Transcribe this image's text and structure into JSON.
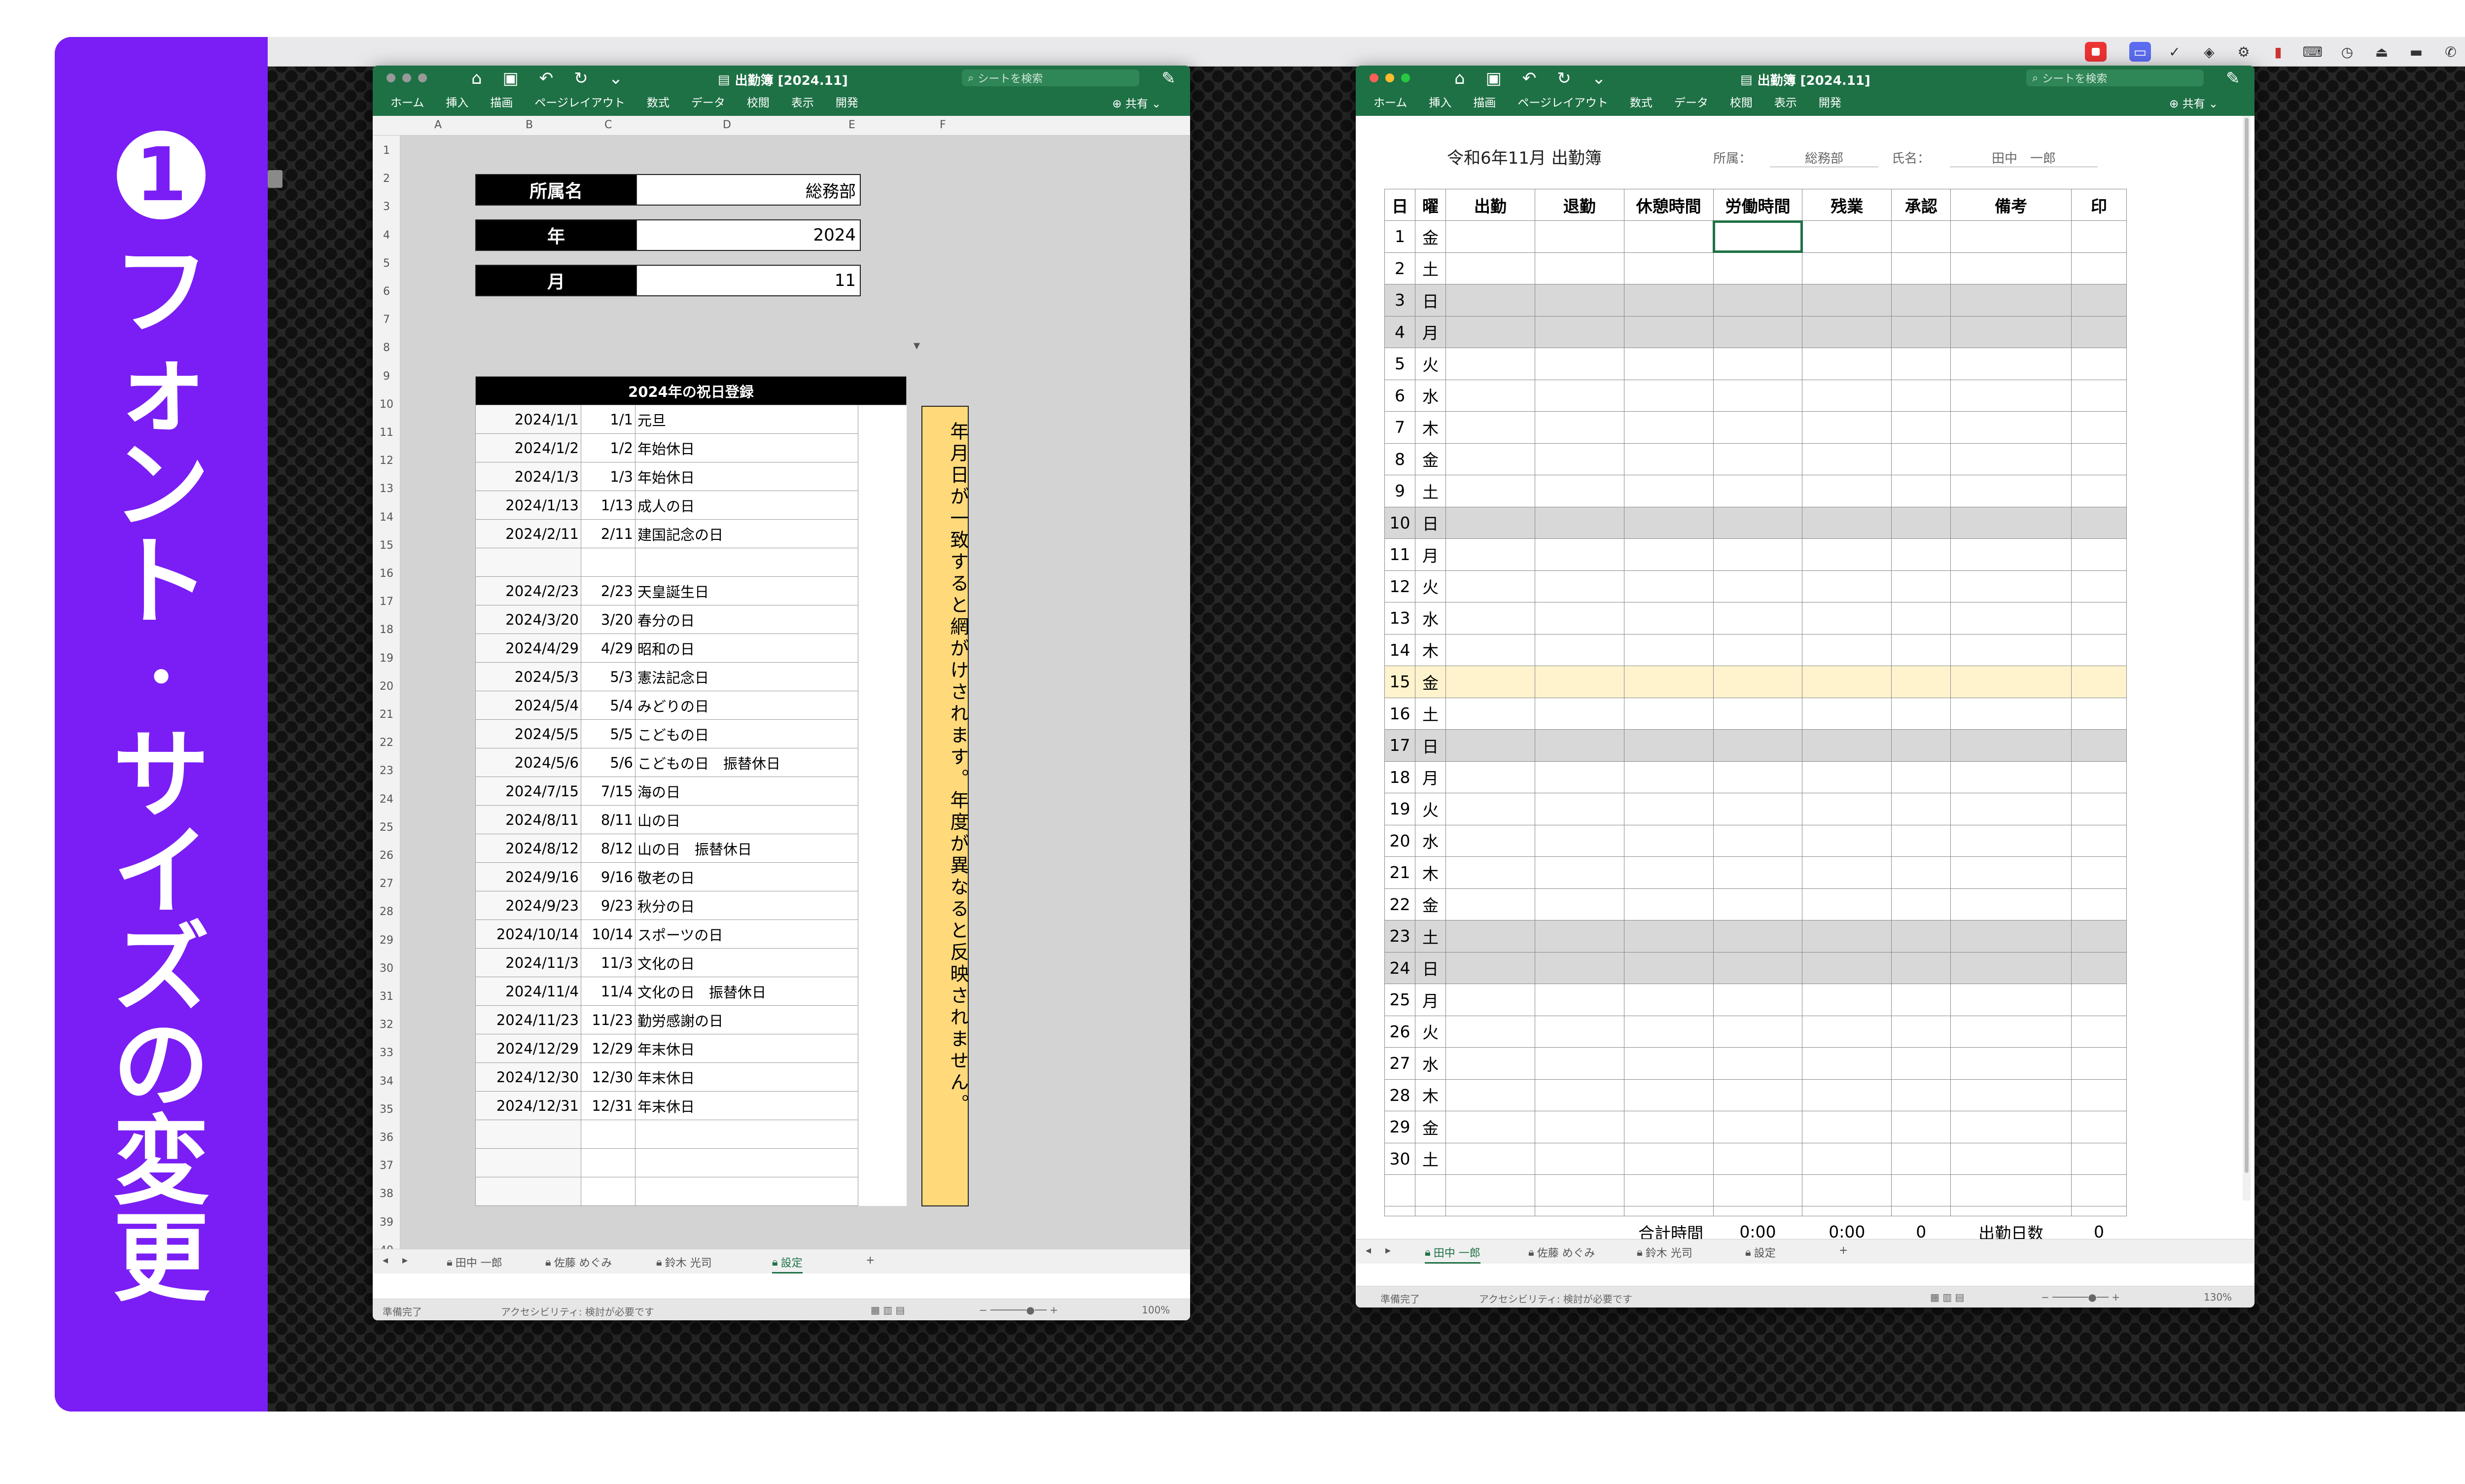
{
  "sidebar": {
    "chars": [
      "1",
      "フ",
      "ォ",
      "ン",
      "ト",
      "・",
      "サ",
      "イ",
      "ズ",
      "の",
      "変",
      "更"
    ]
  },
  "left_window": {
    "title": "出勤簿 [2024.11]",
    "search_placeholder": "シートを検索",
    "ribbon": [
      "ホーム",
      "挿入",
      "描画",
      "ページレイアウト",
      "数式",
      "データ",
      "校閲",
      "表示",
      "開発"
    ],
    "share": "共有",
    "columns": [
      "A",
      "B",
      "C",
      "D",
      "E",
      "F"
    ],
    "rows": [
      "1",
      "2",
      "3",
      "4",
      "5",
      "6",
      "7",
      "8",
      "9",
      "10",
      "11",
      "12",
      "13",
      "14",
      "15",
      "16",
      "17",
      "18",
      "19",
      "20",
      "21",
      "22",
      "23",
      "24",
      "25",
      "26",
      "27",
      "28",
      "29",
      "30",
      "31",
      "32",
      "33",
      "34",
      "35",
      "36",
      "37",
      "38",
      "39",
      "40"
    ],
    "settings": [
      {
        "label": "所属名",
        "value": "総務部"
      },
      {
        "label": "年",
        "value": "2024"
      },
      {
        "label": "月",
        "value": "11"
      }
    ],
    "holiday_title": "2024年の祝日登録",
    "holidays": [
      [
        "2024/1/1",
        "1/1",
        "元旦"
      ],
      [
        "2024/1/2",
        "1/2",
        "年始休日"
      ],
      [
        "2024/1/3",
        "1/3",
        "年始休日"
      ],
      [
        "2024/1/13",
        "1/13",
        "成人の日"
      ],
      [
        "2024/2/11",
        "2/11",
        "建国記念の日"
      ],
      [
        "",
        "",
        ""
      ],
      [
        "2024/2/23",
        "2/23",
        "天皇誕生日"
      ],
      [
        "2024/3/20",
        "3/20",
        "春分の日"
      ],
      [
        "2024/4/29",
        "4/29",
        "昭和の日"
      ],
      [
        "2024/5/3",
        "5/3",
        "憲法記念日"
      ],
      [
        "2024/5/4",
        "5/4",
        "みどりの日"
      ],
      [
        "2024/5/5",
        "5/5",
        "こどもの日"
      ],
      [
        "2024/5/6",
        "5/6",
        "こどもの日　振替休日"
      ],
      [
        "2024/7/15",
        "7/15",
        "海の日"
      ],
      [
        "2024/8/11",
        "8/11",
        "山の日"
      ],
      [
        "2024/8/12",
        "8/12",
        "山の日　振替休日"
      ],
      [
        "2024/9/16",
        "9/16",
        "敬老の日"
      ],
      [
        "2024/9/23",
        "9/23",
        "秋分の日"
      ],
      [
        "2024/10/14",
        "10/14",
        "スポーツの日"
      ],
      [
        "2024/11/3",
        "11/3",
        "文化の日"
      ],
      [
        "2024/11/4",
        "11/4",
        "文化の日　振替休日"
      ],
      [
        "2024/11/23",
        "11/23",
        "勤労感謝の日"
      ],
      [
        "2024/12/29",
        "12/29",
        "年末休日"
      ],
      [
        "2024/12/30",
        "12/30",
        "年末休日"
      ],
      [
        "2024/12/31",
        "12/31",
        "年末休日"
      ],
      [
        "",
        "",
        ""
      ],
      [
        "",
        "",
        ""
      ],
      [
        "",
        "",
        ""
      ]
    ],
    "note": "年月日が一致すると網がけされます。年度が異なると反映されません。",
    "tabs": [
      "田中 一郎",
      "佐藤 めぐみ",
      "鈴木 光司",
      "設定"
    ],
    "status_ready": "準備完了",
    "status_access": "アクセシビリティ: 検討が必要です",
    "zoom": "100%"
  },
  "right_window": {
    "title": "出勤簿 [2024.11]",
    "search_placeholder": "シートを検索",
    "ribbon": [
      "ホーム",
      "挿入",
      "描画",
      "ページレイアウト",
      "数式",
      "データ",
      "校閲",
      "表示",
      "開発"
    ],
    "share": "共有",
    "sheet_title": "令和6年11月 出勤簿",
    "dept_label": "所属：",
    "dept": "総務部",
    "name_label": "氏名：",
    "name": "田中　一郎",
    "headers": [
      "日",
      "曜",
      "出勤",
      "退勤",
      "休憩時間",
      "労働時間",
      "残業",
      "承認",
      "備考",
      "印"
    ],
    "days": [
      [
        "1",
        "金"
      ],
      [
        "2",
        "土"
      ],
      [
        "3",
        "日"
      ],
      [
        "4",
        "月"
      ],
      [
        "5",
        "火"
      ],
      [
        "6",
        "水"
      ],
      [
        "7",
        "木"
      ],
      [
        "8",
        "金"
      ],
      [
        "9",
        "土"
      ],
      [
        "10",
        "日"
      ],
      [
        "11",
        "月"
      ],
      [
        "12",
        "火"
      ],
      [
        "13",
        "水"
      ],
      [
        "14",
        "木"
      ],
      [
        "15",
        "金"
      ],
      [
        "16",
        "土"
      ],
      [
        "17",
        "日"
      ],
      [
        "18",
        "月"
      ],
      [
        "19",
        "火"
      ],
      [
        "20",
        "水"
      ],
      [
        "21",
        "木"
      ],
      [
        "22",
        "金"
      ],
      [
        "23",
        "土"
      ],
      [
        "24",
        "日"
      ],
      [
        "25",
        "月"
      ],
      [
        "26",
        "火"
      ],
      [
        "27",
        "水"
      ],
      [
        "28",
        "木"
      ],
      [
        "29",
        "金"
      ],
      [
        "30",
        "土"
      ]
    ],
    "total_label": "合計時間",
    "total_work": "0:00",
    "total_over": "0:00",
    "total_approve": "0",
    "days_label": "出勤日数",
    "days_count": "0",
    "tabs": [
      "田中 一郎",
      "佐藤 めぐみ",
      "鈴木 光司",
      "設定"
    ],
    "status_ready": "準備完了",
    "status_access": "アクセシビリティ: 検討が必要です",
    "zoom": "130%"
  },
  "colors": {
    "purple": "#7a1ef5",
    "excel_green": "#1e7145",
    "note_yellow": "#ffd97a",
    "weekend_gray": "#d8d8d8"
  }
}
